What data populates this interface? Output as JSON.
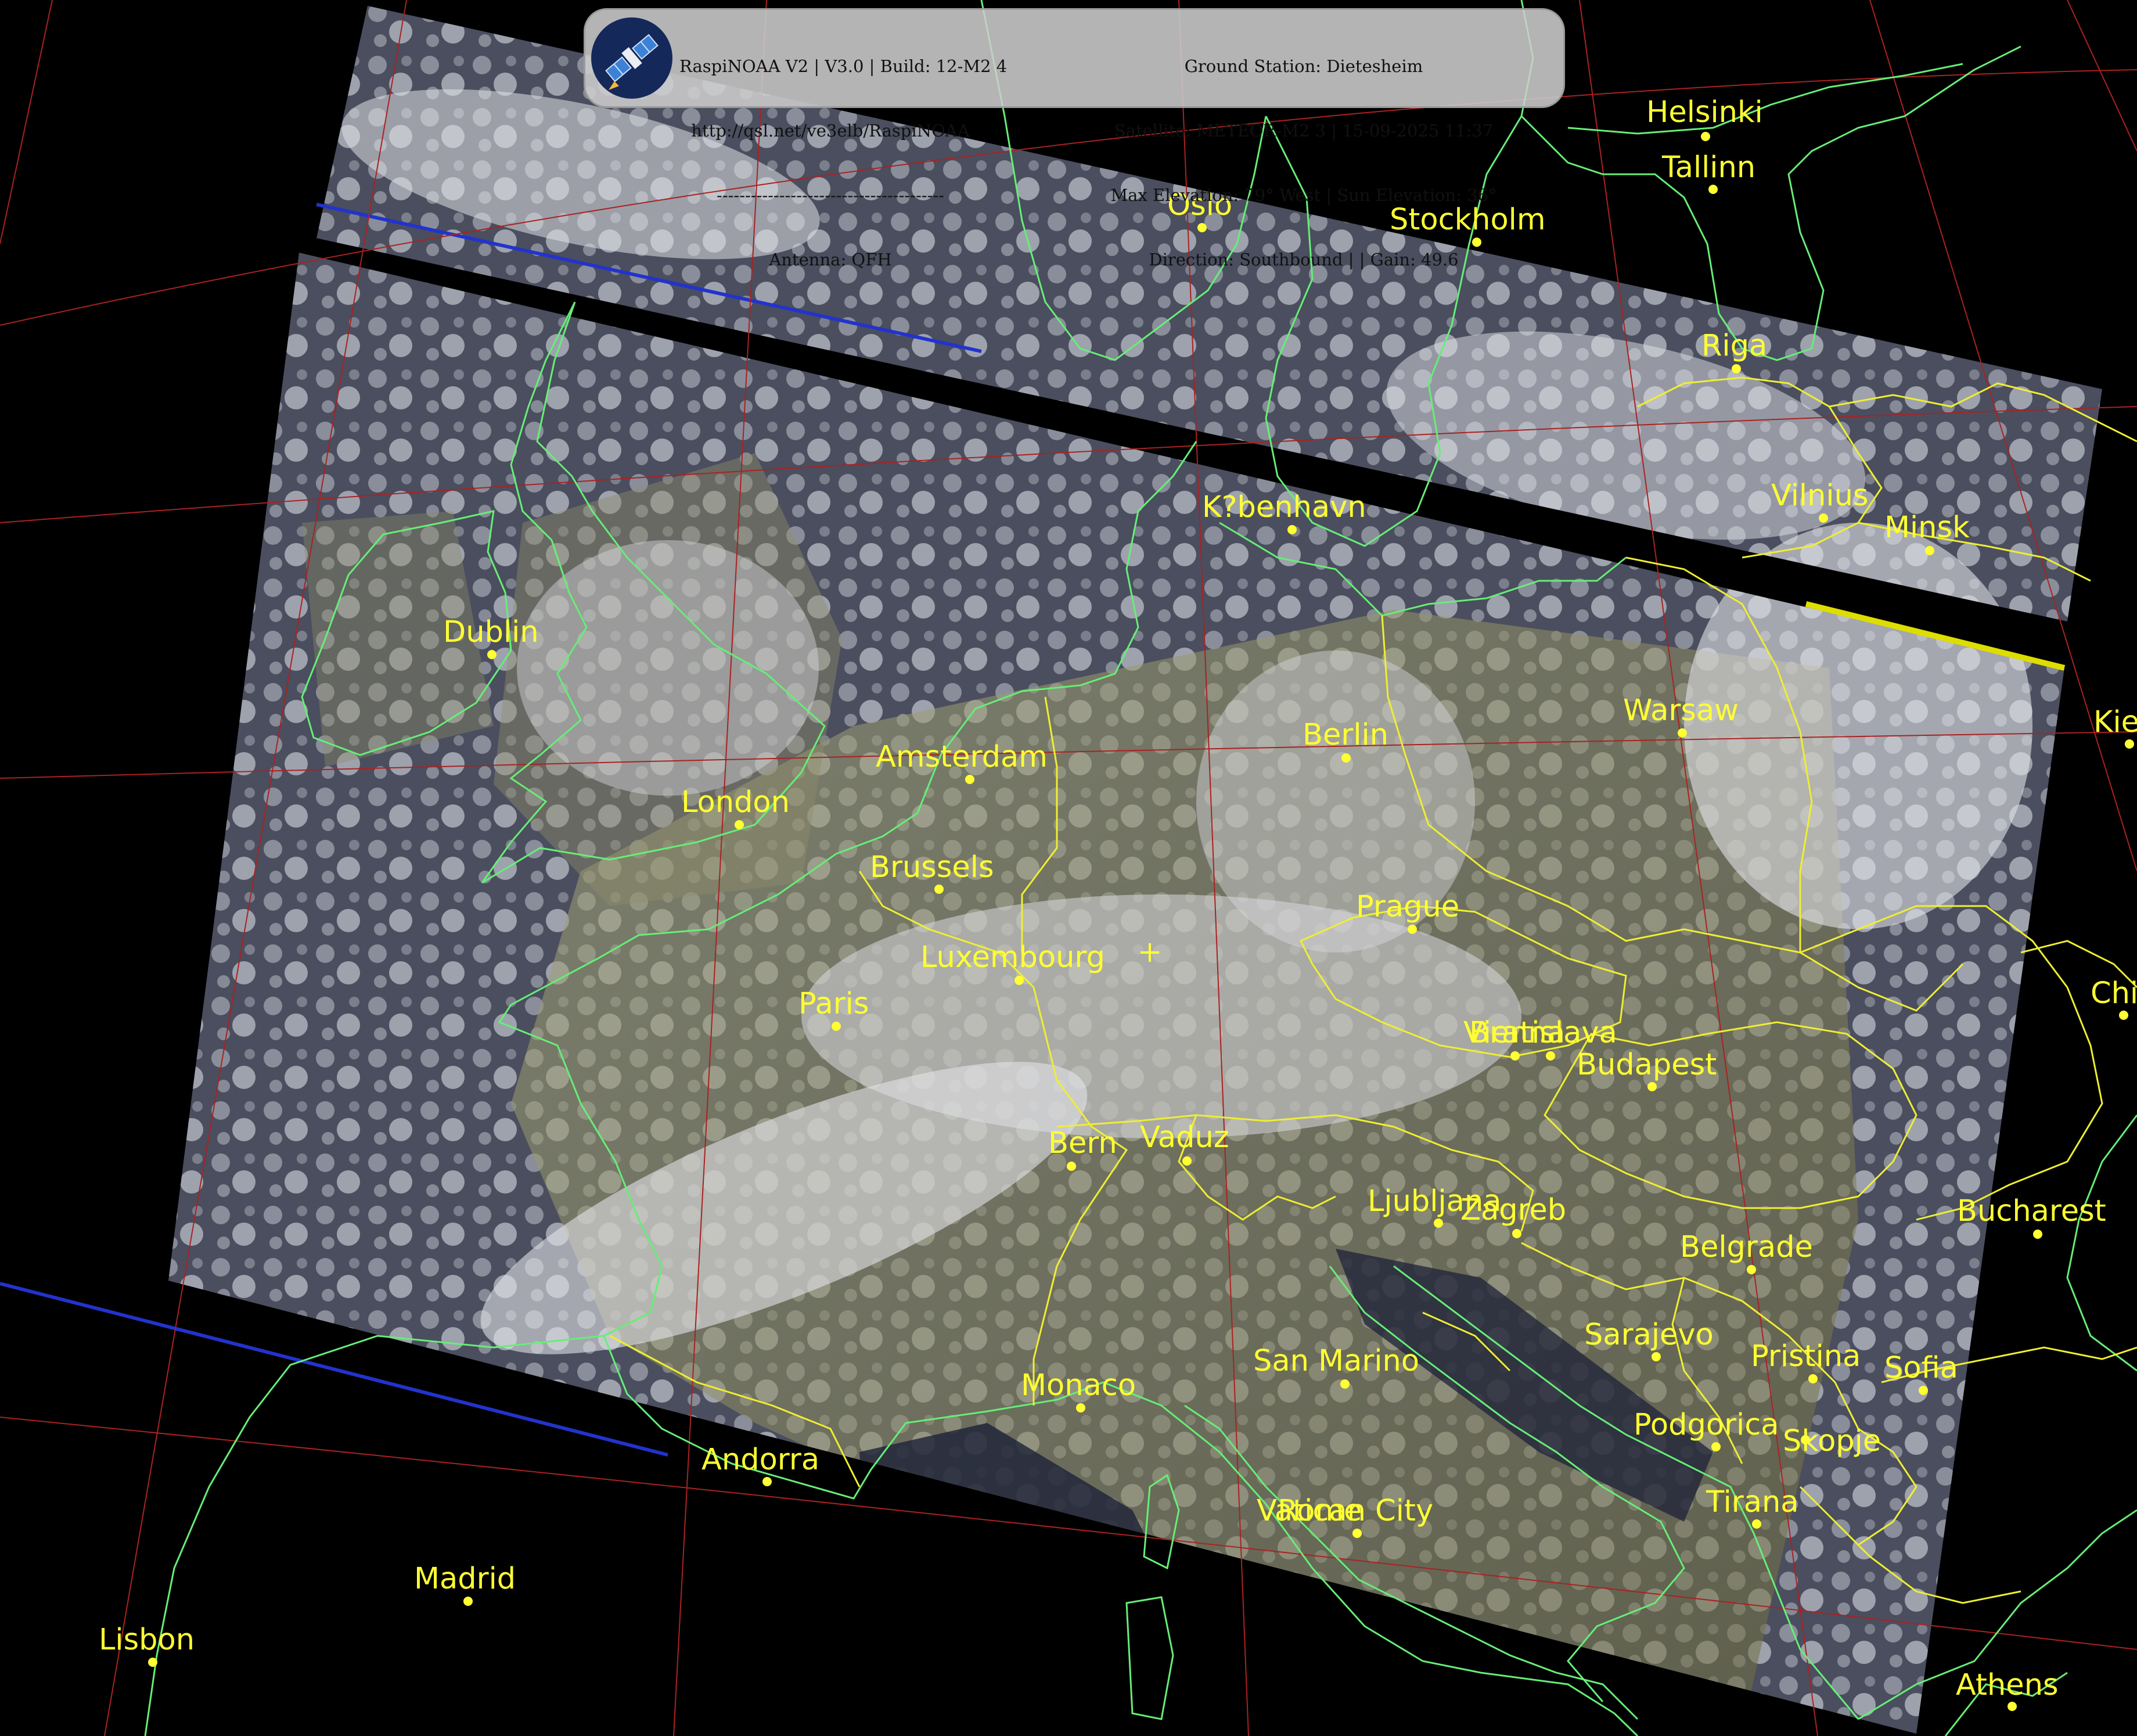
{
  "header": {
    "left_lines": [
      "RaspiNOAA V2 | V3.0 | Build: 12-M2 4",
      "http://qsl.net/ve3elb/RaspiNOAA",
      "----------------------------------------",
      "Antenna: QFH"
    ],
    "right_lines": [
      "Ground Station: Dietesheim",
      "Satellite: METEOR-M2 3 | 15-09-2025 11:37",
      "Max Elevation: 79° West | Sun Elevation: 36°",
      "Direction: Southbound | | Gain: 49.6"
    ]
  },
  "cities": [
    {
      "name": "Helsinki"
    },
    {
      "name": "Tallinn"
    },
    {
      "name": "Oslo"
    },
    {
      "name": "Stockholm"
    },
    {
      "name": "Riga"
    },
    {
      "name": "Vilnius"
    },
    {
      "name": "Minsk"
    },
    {
      "name": "K?benhavn"
    },
    {
      "name": "Dublin"
    },
    {
      "name": "Berlin"
    },
    {
      "name": "Warsaw"
    },
    {
      "name": "Kiev"
    },
    {
      "name": "Amsterdam"
    },
    {
      "name": "London"
    },
    {
      "name": "Brussels"
    },
    {
      "name": "Prague"
    },
    {
      "name": "Luxembourg"
    },
    {
      "name": "Paris"
    },
    {
      "name": "Chisinau"
    },
    {
      "name": "Vienna"
    },
    {
      "name": "Bratislava"
    },
    {
      "name": "Budapest"
    },
    {
      "name": "Vaduz"
    },
    {
      "name": "Bern"
    },
    {
      "name": "Ljubljana"
    },
    {
      "name": "Zagreb"
    },
    {
      "name": "Bucharest"
    },
    {
      "name": "Belgrade"
    },
    {
      "name": "Sarajevo"
    },
    {
      "name": "San Marino"
    },
    {
      "name": "Sofia"
    },
    {
      "name": "Monaco"
    },
    {
      "name": "Pristina"
    },
    {
      "name": "Podgorica"
    },
    {
      "name": "Skopje"
    },
    {
      "name": "Andorra"
    },
    {
      "name": "Tirana"
    },
    {
      "name": "Vatican City"
    },
    {
      "name": "Rome"
    },
    {
      "name": "Madrid"
    },
    {
      "name": "Lisbon"
    },
    {
      "name": "Athens"
    }
  ],
  "colors": {
    "label": "#ffff33",
    "coast": "#66ee77",
    "border": "#eeee33",
    "graticule": "#aa2222"
  }
}
